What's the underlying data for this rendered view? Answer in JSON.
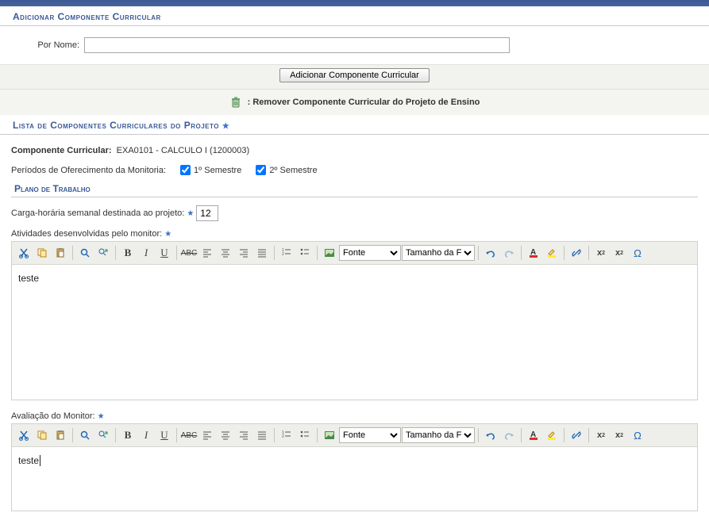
{
  "sections": {
    "add_header": "Adicionar Componente Curricular",
    "list_header": "Lista de Componentes Curriculares do Projeto",
    "plan_header": "Plano de Trabalho"
  },
  "form": {
    "por_nome_label": "Por Nome:",
    "por_nome_value": "",
    "add_button": "Adicionar Componente Curricular",
    "remove_instruction": ": Remover Componente Curricular do Projeto de Ensino"
  },
  "componente": {
    "label": "Componente Curricular:",
    "value": "EXA0101 - CALCULO I (1200003)"
  },
  "periodos": {
    "label": "Períodos de Oferecimento da Monitoria:",
    "sem1_checked": true,
    "sem1_label": "1º Semestre",
    "sem2_checked": true,
    "sem2_label": "2º Semestre"
  },
  "carga": {
    "label": "Carga-horária semanal destinada ao projeto:",
    "value": "12"
  },
  "atividades": {
    "label": "Atividades desenvolvidas pelo monitor:",
    "content": "teste"
  },
  "avaliacao": {
    "label": "Avaliação do Monitor:",
    "content": "teste"
  },
  "toolbar": {
    "font_label": "Fonte",
    "size_label": "Tamanho da Fo"
  },
  "req_star": "★"
}
